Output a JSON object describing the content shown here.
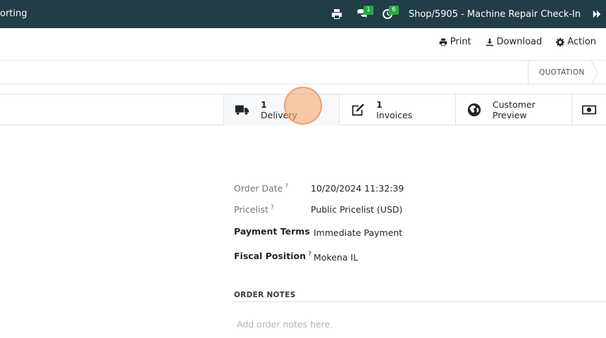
{
  "navbar": {
    "menu_text": "orting",
    "messages_count": "1",
    "activities_count": "6",
    "title": "Shop/5905 - Machine Repair Check-In",
    "icons": [
      "print-icon",
      "comments-icon",
      "clock-icon",
      "expand-icon"
    ]
  },
  "actions": {
    "print": "Print",
    "download": "Download",
    "action": "Action"
  },
  "status": {
    "stage": "QUOTATION"
  },
  "smart_buttons": {
    "delivery": {
      "count": "1",
      "label": "Delivery"
    },
    "invoices": {
      "count": "1",
      "label": "Invoices"
    },
    "preview": {
      "line1": "Customer",
      "line2": "Preview"
    }
  },
  "form": {
    "order_date_label": "Order Date",
    "order_date_value": "10/20/2024 11:32:39",
    "pricelist_label": "Pricelist",
    "pricelist_value": "Public Pricelist (USD)",
    "payment_terms_label": "Payment Terms",
    "payment_terms_value": "Immediate Payment",
    "fiscal_position_label": "Fiscal Position",
    "fiscal_position_value": "Mokena IL",
    "help_mark": "?"
  },
  "order_notes": {
    "title": "ORDER NOTES",
    "placeholder": "Add order notes here."
  }
}
